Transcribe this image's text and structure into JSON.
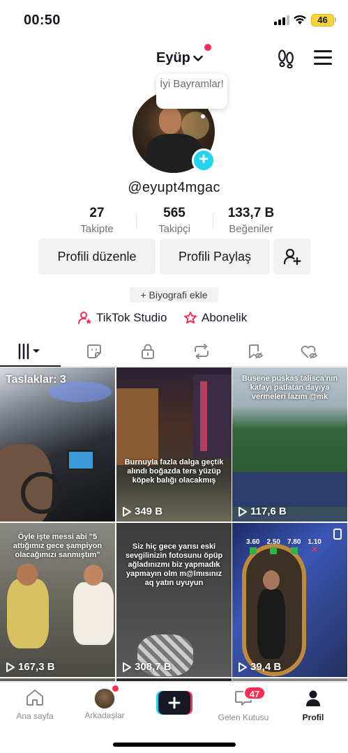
{
  "status_bar": {
    "time": "00:50",
    "battery": "46"
  },
  "header": {
    "account_name": "Eyüp"
  },
  "profile": {
    "bubble_text": "İyi Bayramlar!",
    "username": "@eyupt4mgac",
    "stats": [
      {
        "value": "27",
        "label": "Takipte"
      },
      {
        "value": "565",
        "label": "Takipçi"
      },
      {
        "value": "133,7 B",
        "label": "Beğeniler"
      }
    ],
    "edit_profile_label": "Profili düzenle",
    "share_profile_label": "Profili Paylaş",
    "add_bio_label": "+ Biyografi ekle",
    "studio_label": "TikTok Studio",
    "subscription_label": "Abonelik"
  },
  "grid": {
    "drafts_label": "Taslaklar: 3",
    "videos": [
      {
        "views": "",
        "caption": ""
      },
      {
        "views": "349 B",
        "caption": "Burnuyla fazla dalga geçtik alındı boğazda ters yüzüp köpek balığı olacakmış"
      },
      {
        "views": "117,6 B",
        "caption": "Busene puskas talisca'nın kafayı patlatan dayıya vermeleri lazım @mk"
      },
      {
        "views": "167,3 B",
        "caption": "Öyle işte messi abi \"5 attığımız gece şampiyon olacağımızı sanmıştım\""
      },
      {
        "views": "308,7 B",
        "caption": "Siz hiç gece yarısı eski sevgilinizin fotosunu öpüp ağladınızmı biz yapmadık yapmayın olm m@lmısınız aq yatın uyuyun"
      },
      {
        "views": "39,4 B",
        "caption": ""
      }
    ],
    "odds": [
      "3.60",
      "2.50",
      "7.80",
      "1.10"
    ]
  },
  "bottom_nav": {
    "home": "Ana sayfa",
    "friends": "Arkadaşlar",
    "inbox": "Gelen Kutusu",
    "inbox_badge": "47",
    "profile": "Profil"
  },
  "colors": {
    "accent_red": "#fe2c55",
    "accent_cyan": "#20d5ec",
    "text": "#161823"
  }
}
